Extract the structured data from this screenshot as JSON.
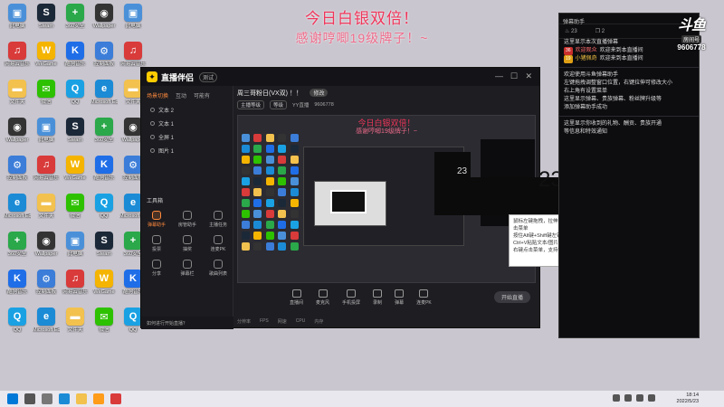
{
  "overlay": {
    "line1": "今日白银双倍！",
    "line2": "感谢哼唧19级牌子！~"
  },
  "desktop_icons": [
    {
      "label": "此电脑",
      "color": "#4a90d9",
      "glyph": "▣"
    },
    {
      "label": "网易云音乐",
      "color": "#d93a3a",
      "glyph": "♫"
    },
    {
      "label": "文件夹",
      "color": "#f2c14e",
      "glyph": "▬"
    },
    {
      "label": "Wallpaper",
      "color": "#333333",
      "glyph": "◉"
    },
    {
      "label": "控制面板",
      "color": "#3b7dd8",
      "glyph": "⚙"
    },
    {
      "label": "Microsoft Edge",
      "color": "#1b8bd6",
      "glyph": "e"
    },
    {
      "label": "360安全",
      "color": "#2aa84a",
      "glyph": "+"
    },
    {
      "label": "酷狗音乐",
      "color": "#1f6ee8",
      "glyph": "K"
    },
    {
      "label": "QQ",
      "color": "#1aa1e3",
      "glyph": "Q"
    },
    {
      "label": "Steam",
      "color": "#1b2838",
      "glyph": "S"
    },
    {
      "label": "WeGame",
      "color": "#f4b400",
      "glyph": "W"
    },
    {
      "label": "微信",
      "color": "#2dc100",
      "glyph": "✉"
    }
  ],
  "app": {
    "name": "直播伴侣",
    "version": "测试",
    "tabs": [
      "场景切换",
      "互动",
      "可能有"
    ],
    "scenes": [
      "文本 2",
      "文本 1",
      "全屏 1",
      "图片 1"
    ],
    "tools_title": "工具箱",
    "tools": [
      "弹幕助手",
      "房管助手",
      "主播任务",
      "投票",
      "抽奖",
      "连麦PK",
      "分享",
      "弹幕栏",
      "歌曲列表"
    ],
    "stream_title": "周三哥粉日(VX双) ！！",
    "stream_badge": "修改",
    "stream_meta": [
      "主播等级",
      "等级",
      "YY直播",
      "9606778"
    ],
    "preview_text1": "今日白银双倍！",
    "preview_text2": "感谢哼唧19级牌子！~",
    "bottom_buttons": [
      "直播间",
      "麦克风",
      "手机投屏",
      "录制",
      "弹幕",
      "连麦PK"
    ],
    "live_button": "开始直播",
    "status": "如何进行开始直播？",
    "footer": [
      "分辨率",
      "FPS",
      "网速",
      "CPU",
      "内存"
    ]
  },
  "tooltip": {
    "lines": [
      "鼠标左键拖拽，拉伸改变大小和位置，右键单击菜单",
      "按住Alt键+Shift键左键拉伸可以裁剪画面",
      "Ctrl+V粘贴文本/图片",
      "右键点击菜单，支持\"贴图\"功能"
    ]
  },
  "dates": {
    "left": "23",
    "right": "23日"
  },
  "chat": {
    "header": "弹幕助手",
    "stats": [
      "23",
      "2"
    ],
    "lines": [
      {
        "type": "system",
        "text": "这里显示本次直播弹幕"
      },
      {
        "type": "user",
        "tag": "36",
        "nick": "欢迎观众",
        "text": "欢迎来到本直播间",
        "tone": "red"
      },
      {
        "type": "user",
        "tag": "19",
        "nick": "小猪佩奇",
        "text": "欢迎来到本直播间",
        "tone": "yellow"
      },
      {
        "type": "sep"
      },
      {
        "type": "system",
        "text": "欢迎使用斗鱼弹幕助手"
      },
      {
        "type": "system",
        "text": "左键拖拽调整窗口位置，右键拉伸可修改大小"
      },
      {
        "type": "system",
        "text": "右上角有设置菜单"
      },
      {
        "type": "system",
        "text": "这里显示弹幕、贵族弹幕、粉丝牌升级等"
      },
      {
        "type": "system",
        "text": "添加弹幕助手成功"
      },
      {
        "type": "sep"
      },
      {
        "type": "system",
        "text": "这里显示你收到的礼物、酬贡、贵族开通"
      },
      {
        "type": "system",
        "text": "等信息和特效通知"
      }
    ]
  },
  "room": {
    "logo": "斗鱼",
    "label": "房间号",
    "number": "9606778"
  },
  "taskbar": {
    "time": "18:14",
    "date": "2022/5/23"
  }
}
